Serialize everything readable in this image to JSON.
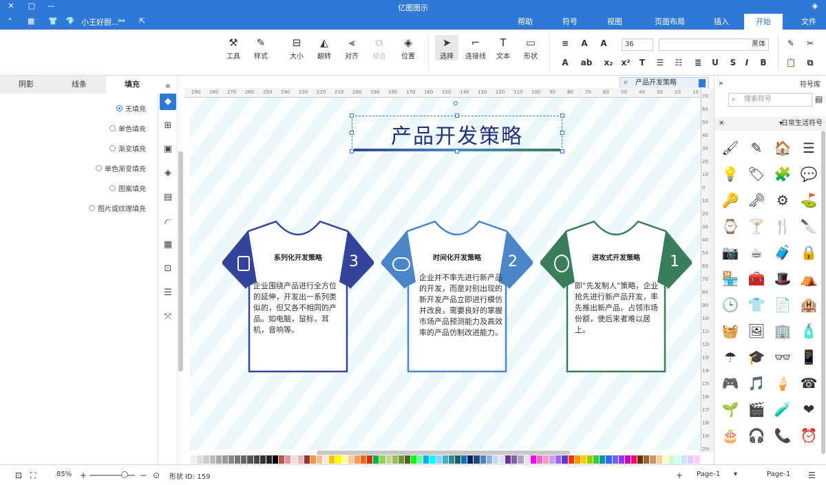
{
  "app": {
    "title": "亿图图示"
  },
  "quick_access": {
    "doc_name": "小王好厨..."
  },
  "menu": {
    "tabs": [
      "文件",
      "开始",
      "插入",
      "页面布局",
      "视图",
      "符号",
      "帮助"
    ]
  },
  "ribbon": {
    "font_name": "黑体",
    "font_size": "36",
    "tools": {
      "select": "选择",
      "connector": "连接线",
      "text": "文本",
      "shape": "形状",
      "tool": "工具",
      "style": "样式",
      "size": "大小",
      "flip": "翻转",
      "align": "对齐",
      "group": "组合",
      "position": "位置"
    }
  },
  "left_panel": {
    "tabs": [
      "填充",
      "线条",
      "阴影"
    ],
    "fill_options": [
      "无填充",
      "单色填充",
      "渐变填充",
      "单色渐变填充",
      "图案填充",
      "图片或纹理填充"
    ],
    "selected_fill": "无填充"
  },
  "doc_tab": {
    "label": "产品开发策略"
  },
  "ruler_h": [
    "290",
    "280",
    "270",
    "260",
    "250",
    "240",
    "230",
    "220",
    "210",
    "200",
    "190",
    "180",
    "170",
    "160",
    "150",
    "140",
    "130",
    "120",
    "110",
    "100",
    "90",
    "80",
    "70",
    "60",
    "50",
    "40",
    "30",
    "20",
    "10",
    "0"
  ],
  "ruler_v": [
    "70",
    "60",
    "50",
    "40",
    "30",
    "20",
    "10",
    "0",
    "10",
    "20",
    "30",
    "40",
    "50",
    "60",
    "70",
    "80",
    "90",
    "100",
    "110",
    "120",
    "130",
    "140",
    "150",
    "160",
    "170",
    "180",
    "190",
    "200"
  ],
  "diagram": {
    "title": "产品开发策略",
    "shirts": [
      {
        "number": "3",
        "heading": "系列化开发策略",
        "body": "企业围绕产品进行全方位的延伸，开发出一系列类似的，但又各不相同的产品。如电脑，鼠标，耳机，音响等。",
        "color": "#33449a"
      },
      {
        "number": "2",
        "heading": "时间化开发策略",
        "body": "企业并不率先进行新产品的开发，而是对别出现的新开发产品立即进行模仿并改良，需要良好的掌握市场产品预测能力及高效率的产品仿制改进能力。",
        "color": "#4a86c8"
      },
      {
        "number": "1",
        "heading": "进攻式开发策略",
        "body": "即“先发制人”策略，企业抢先进行新产品开发，率先推出新产品，占领市场份额，使后来者难以居上。",
        "color": "#3a7d5a"
      }
    ]
  },
  "right_panel": {
    "title": "符号库",
    "search_placeholder": "搜索符号",
    "library": "日常生活符号",
    "symbols": [
      "🖌",
      "✎",
      "🏠",
      "☰",
      "💡",
      "🏷",
      "🧩",
      "💬",
      "🔑",
      "🗝",
      "⚙",
      "⛳",
      "⌚",
      "🍸",
      "🍴",
      "🔪",
      "📷",
      "☕",
      "🧳",
      "🔒",
      "🏪",
      "🧰",
      "🎩",
      "⛺",
      "🕒",
      "👕",
      "📄",
      "🏨",
      "🧺",
      "🖼",
      "🏢",
      "🧴",
      "☂",
      "🎓",
      "👓",
      "📱",
      "🎮",
      "🎵",
      "🍦",
      "☎",
      "🌱",
      "🎬",
      "🧪",
      "❤",
      "🎂",
      "🎧",
      "📞",
      "⏰"
    ]
  },
  "status": {
    "page_name": "Page-1",
    "page_label": "Page-1",
    "zoom": "85%",
    "shape_id": "形状 ID: 159"
  },
  "palette": [
    "#ffffff",
    "#eeeeee",
    "#dddddd",
    "#cccccc",
    "#bbbbbb",
    "#aaaaaa",
    "#999999",
    "#888888",
    "#777777",
    "#666666",
    "#555555",
    "#444444",
    "#333333",
    "#222222",
    "#000000",
    "#c0504d",
    "#d99694",
    "#f2dcdb",
    "#e6b8b7",
    "#953734",
    "#f79646",
    "#fabf8f",
    "#fde9d9",
    "#ffc000",
    "#ffff00",
    "#ffff99",
    "#ffcc99",
    "#ff9966",
    "#ff6600",
    "#cc3300",
    "#00b050",
    "#92d050",
    "#c4d79b",
    "#9bbb59",
    "#76923c",
    "#4f6228",
    "#00ff00",
    "#66ff99",
    "#00b0f0",
    "#00ffff",
    "#99ccff",
    "#4bacc6",
    "#31859c",
    "#215968",
    "#0070c0",
    "#002060",
    "#1f497d",
    "#4f81bd",
    "#8db3e2",
    "#c6d9f1",
    "#dbe5f1",
    "#7030a0",
    "#8064a2",
    "#b2a1c7",
    "#e5e0ec",
    "#ff00ff",
    "#ff66cc",
    "#ff99cc",
    "#cc99ff",
    "#9966ff",
    "#6633cc",
    "#ff3300",
    "#ff9900",
    "#ffcc00",
    "#99cc00",
    "#33cc33",
    "#009999",
    "#3366ff",
    "#6666ff",
    "#9933ff",
    "#cc00cc",
    "#ff0066",
    "#663300",
    "#996633",
    "#cc9966",
    "#ffcc99",
    "#ffffcc",
    "#ccffcc",
    "#ccffff",
    "#cce5ff",
    "#e5ccff",
    "#ffccff"
  ]
}
